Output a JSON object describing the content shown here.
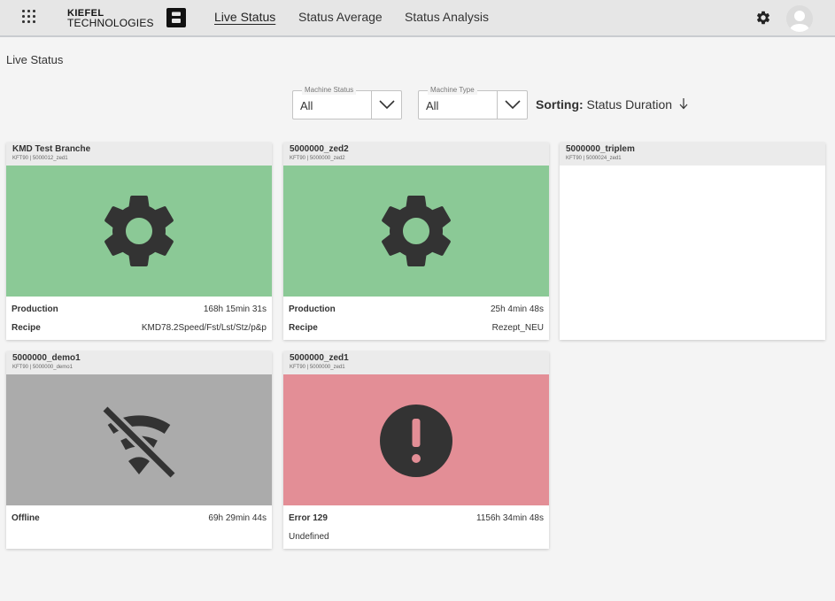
{
  "colors": {
    "production": "#8bc996",
    "offline": "#ababab",
    "error": "#e38e96",
    "icon": "#333333"
  },
  "header": {
    "apps_icon": "grid-icon",
    "logo_line1": "KIEFEL",
    "logo_line2": "TECHNOLOGIES",
    "logo_mark_icon": "kiefel-b-logo-icon",
    "nav": [
      {
        "label": "Live Status",
        "active": true
      },
      {
        "label": "Status Average",
        "active": false
      },
      {
        "label": "Status Analysis",
        "active": false
      }
    ],
    "settings_icon": "gear-icon",
    "avatar_icon": "user-avatar-icon"
  },
  "page": {
    "title": "Live Status"
  },
  "filters": {
    "machine_status": {
      "label": "Machine Status",
      "value": "All"
    },
    "machine_type": {
      "label": "Machine Type",
      "value": "All"
    },
    "sorting": {
      "label": "Sorting:",
      "value": "Status Duration",
      "direction_icon": "arrow-down-icon"
    }
  },
  "cards": [
    {
      "title": "KMD Test Branche",
      "subtitle": "KFT90 | 5000012_zed1",
      "status_icon": "gear-icon",
      "state": "production",
      "row1": {
        "label": "Production",
        "value": "168h 15min 31s"
      },
      "row2": {
        "label": "Recipe",
        "value": "KMD78.2Speed/Fst/Lst/Stz/p&p"
      }
    },
    {
      "title": "5000000_zed2",
      "subtitle": "KFT90 | 5000000_zed2",
      "status_icon": "gear-icon",
      "state": "production",
      "row1": {
        "label": "Production",
        "value": "25h 4min 48s"
      },
      "row2": {
        "label": "Recipe",
        "value": "Rezept_NEU"
      }
    },
    {
      "title": "5000000_triplem",
      "subtitle": "KFT90 | 5000024_zed1",
      "state": "empty"
    },
    {
      "title": "5000000_demo1",
      "subtitle": "KFT90 | 5000000_demo1",
      "status_icon": "wifi-off-icon",
      "state": "offline",
      "row1": {
        "label": "Offline",
        "value": "69h 29min 44s"
      }
    },
    {
      "title": "5000000_zed1",
      "subtitle": "KFT90 | 5000000_zed1",
      "status_icon": "error-icon",
      "state": "error",
      "row1": {
        "label": "Error 129",
        "value": "1156h 34min 48s"
      },
      "row2": {
        "label": "Undefined"
      }
    }
  ]
}
